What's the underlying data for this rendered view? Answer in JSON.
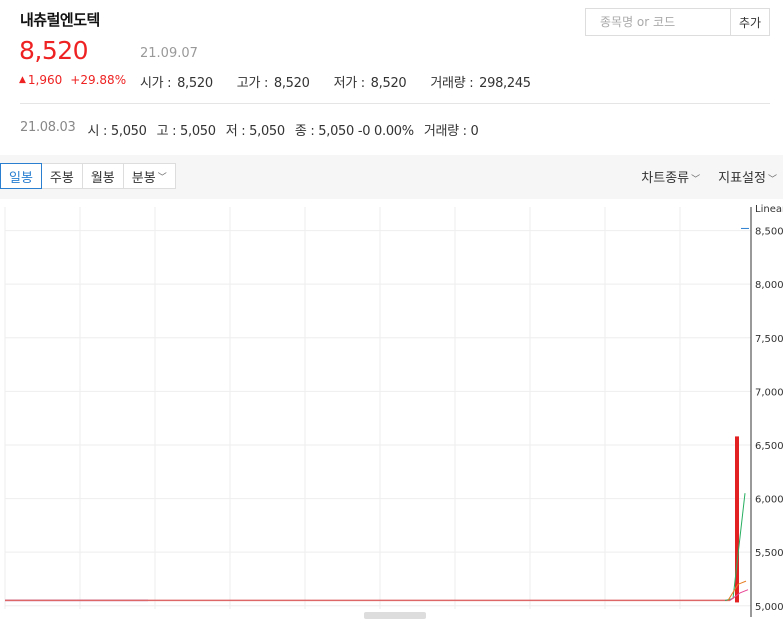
{
  "stock": {
    "name": "내츄럴엔도텍",
    "price": "8,520",
    "date": "21.09.07",
    "change": "1,960",
    "change_pct": "+29.88%",
    "color_up": "#e22222"
  },
  "metrics": [
    {
      "label": "시가",
      "value": "8,520"
    },
    {
      "label": "고가",
      "value": "8,520"
    },
    {
      "label": "저가",
      "value": "8,520"
    },
    {
      "label": "거래량",
      "value": "298,245"
    }
  ],
  "search": {
    "placeholder": "종목명 or 코드",
    "add_label": "추가"
  },
  "prev": {
    "date": "21.08.03",
    "open": "시 : 5,050",
    "high": "고 : 5,050",
    "low": "저 : 5,050",
    "close": "종 : 5,050 -0 0.00%",
    "volume": "거래량 : 0"
  },
  "tabs": [
    "일봉",
    "주봉",
    "월봉",
    "분봉"
  ],
  "tools": {
    "chart_type": "차트종류",
    "indicator": "지표설정"
  },
  "chart_data": {
    "type": "line",
    "scale_label": "Linear",
    "ylim": [
      4970,
      8720
    ],
    "y_ticks": [
      "8,500",
      "8,000",
      "7,500",
      "7,000",
      "6,500",
      "6,000",
      "5,500",
      "5,000"
    ],
    "y_tick_values": [
      8500,
      8000,
      7500,
      7000,
      6500,
      6000,
      5500,
      5000
    ],
    "base_price": 5050,
    "last_price": 8520,
    "volume_bar_top": 6580,
    "grid": true
  }
}
